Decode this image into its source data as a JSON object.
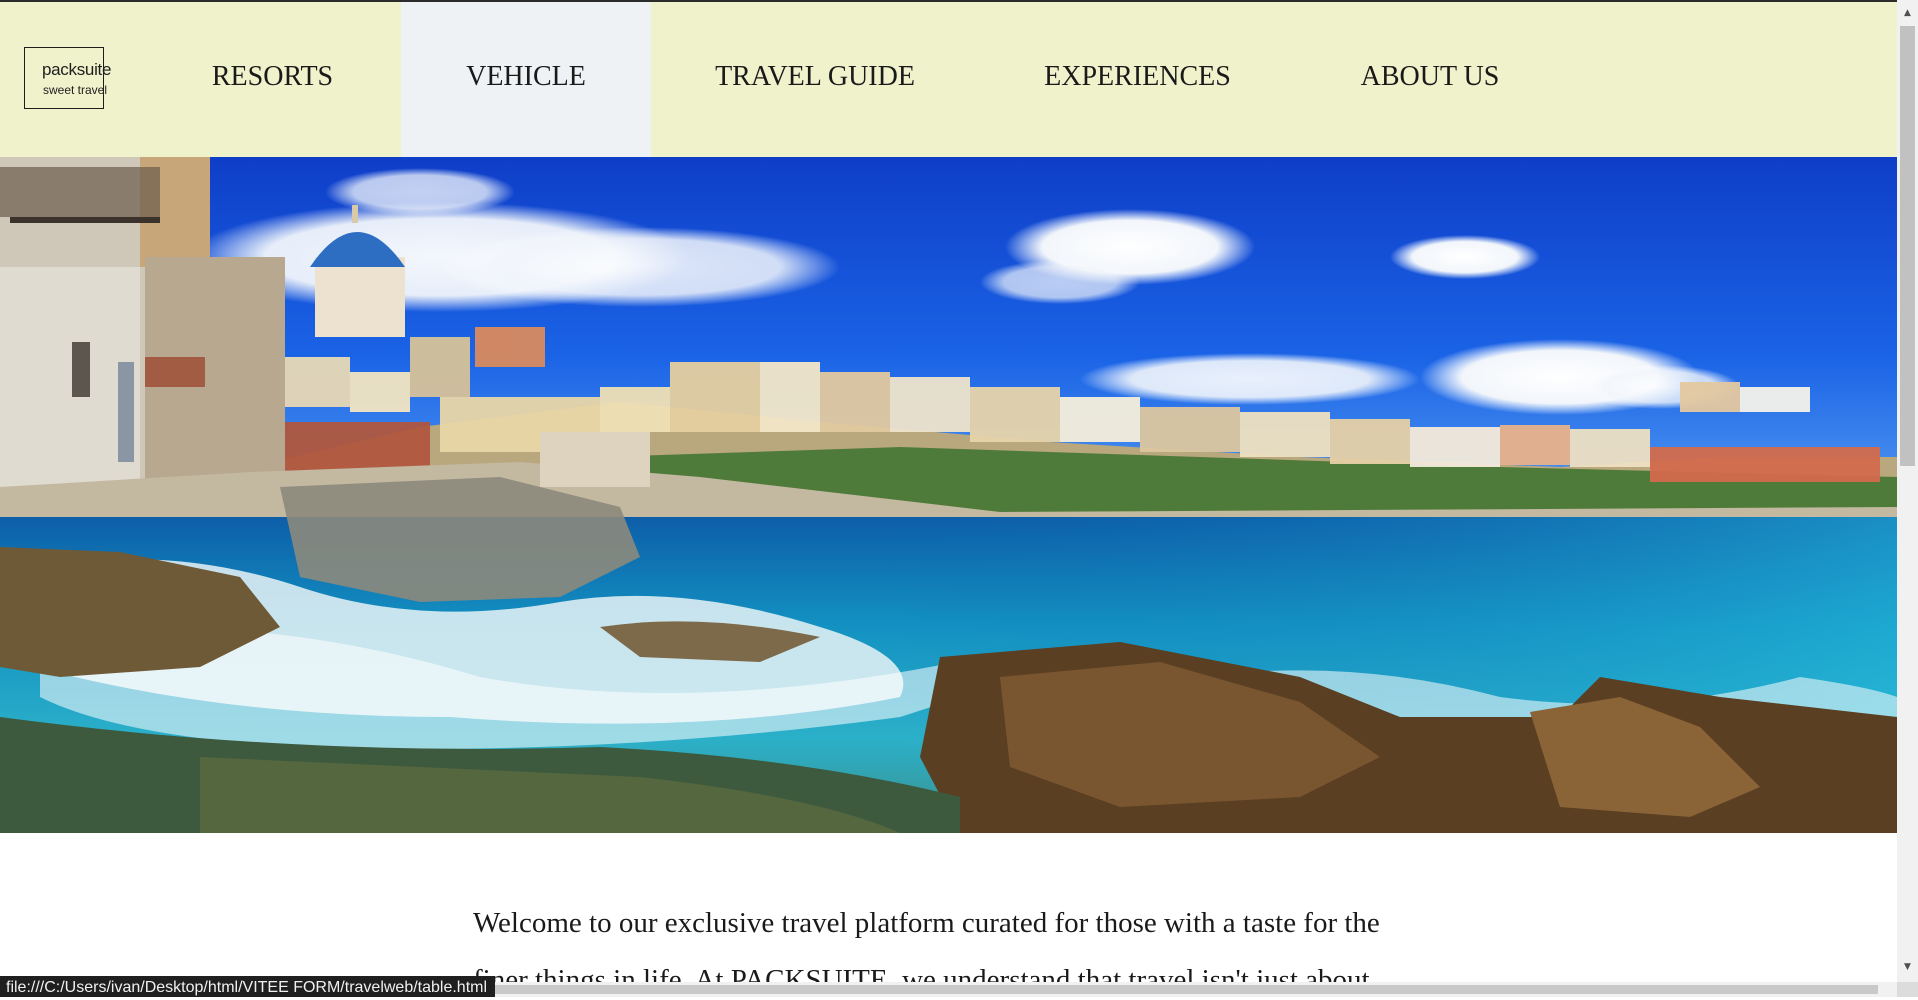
{
  "logo": {
    "name": "packsuite",
    "tagline": "sweet travel"
  },
  "nav": {
    "items": [
      {
        "label": "RESORTS"
      },
      {
        "label": "VEHICLE",
        "active": true
      },
      {
        "label": "TRAVEL GUIDE"
      },
      {
        "label": "EXPERIENCES"
      },
      {
        "label": "ABOUT US"
      }
    ]
  },
  "hero": {
    "image": "coastal-town-seaside-photo"
  },
  "intro": {
    "line1": "Welcome to our exclusive travel platform curated for those with a taste for the",
    "line2": "finer things in life. At PACKSUITE, we understand that travel isn't just about"
  },
  "status": {
    "url": "file:///C:/Users/ivan/Desktop/html/VITEE FORM/travelweb/table.html"
  },
  "colors": {
    "nav_background": "#eff2cb",
    "nav_active_background": "#eef2f4",
    "text": "#1a1a1a"
  }
}
